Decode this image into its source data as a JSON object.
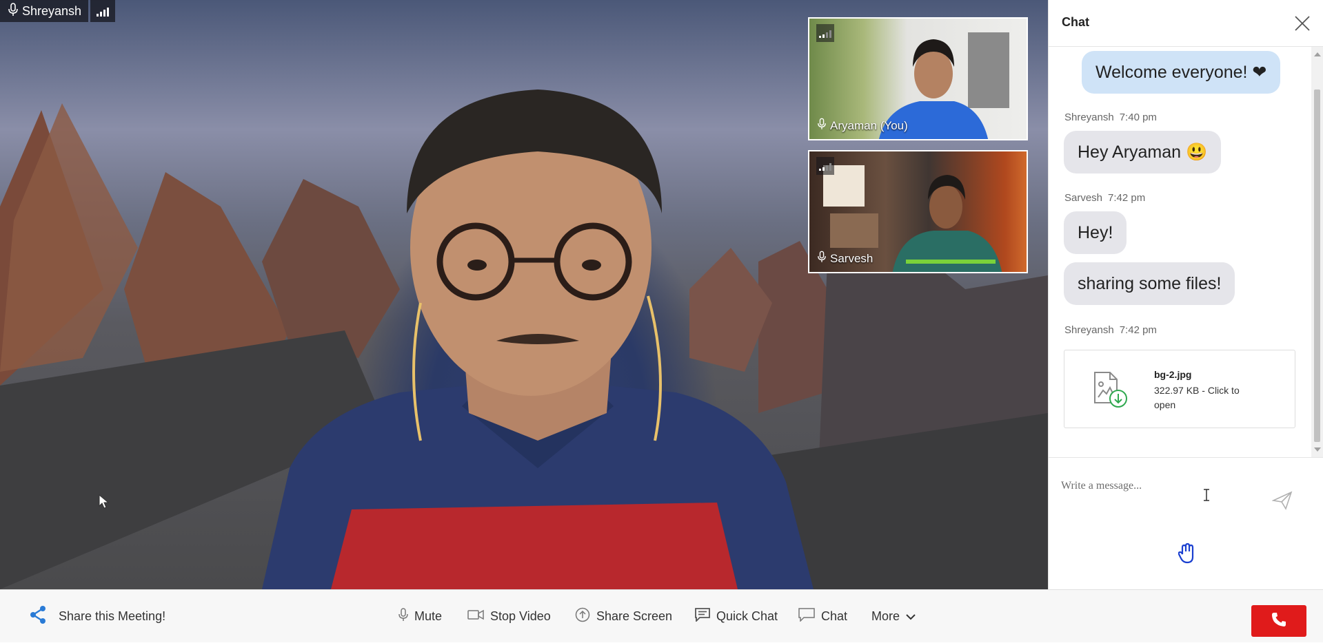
{
  "stage": {
    "speaker_name": "Shreyansh"
  },
  "thumbnails": [
    {
      "name": "Aryaman (You)"
    },
    {
      "name": "Sarvesh"
    }
  ],
  "chat": {
    "title": "Chat",
    "messages": {
      "welcome": "Welcome everyone! ❤",
      "meta1": {
        "sender": "Shreyansh",
        "time": "7:40 pm"
      },
      "hey_aryaman": "Hey Aryaman 😃",
      "meta2": {
        "sender": "Sarvesh",
        "time": "7:42 pm"
      },
      "hey": "Hey!",
      "sharing": "sharing some files!",
      "meta3": {
        "sender": "Shreyansh",
        "time": "7:42 pm"
      },
      "file": {
        "name": "bg-2.jpg",
        "size_text": "322.97 KB - Click to open"
      }
    },
    "compose": {
      "placeholder": "Write a message..."
    }
  },
  "toolbar": {
    "share_meeting": "Share this Meeting!",
    "mute": "Mute",
    "stop_video": "Stop Video",
    "share_screen": "Share Screen",
    "quick_chat": "Quick Chat",
    "chat": "Chat",
    "more": "More"
  },
  "colors": {
    "end_call": "#e01b1b",
    "outgoing_bubble": "#cfe3f7",
    "incoming_bubble": "#e5e5ea",
    "share_icon": "#2a7bd6",
    "raise_hand_icon": "#1a3fd0"
  },
  "icons": [
    "mic-icon",
    "signal-icon",
    "close-icon",
    "file-download-icon",
    "send-icon",
    "raise-hand-icon",
    "share-icon",
    "video-camera-icon",
    "share-screen-icon",
    "quick-chat-icon",
    "chat-icon",
    "chevron-down-icon",
    "phone-icon"
  ]
}
